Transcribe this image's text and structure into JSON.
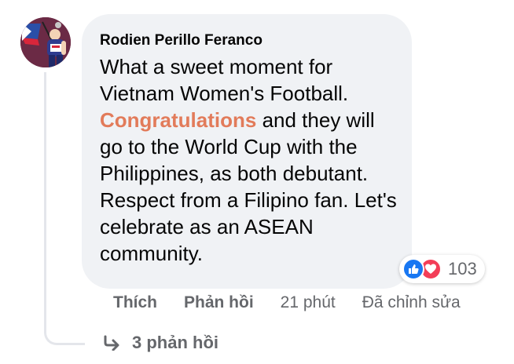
{
  "comment": {
    "author": "Rodien Perillo Feranco",
    "text_before": "What a sweet moment for Vietnam Women's Football.",
    "highlight": "Congratulations",
    "text_after": "and they will go to the World Cup with the Philippines, as both debutant. Respect from a Filipino fan. Let's celebrate as an ASEAN community."
  },
  "reactions": {
    "icons": [
      "like-icon",
      "love-icon"
    ],
    "count": "103",
    "like_color": "#1877f2",
    "love_color": "#f33e58"
  },
  "actions": {
    "like_label": "Thích",
    "reply_label": "Phản hồi",
    "time": "21 phút",
    "edited": "Đã chỉnh sửa"
  },
  "replies": {
    "label": "3 phản hồi",
    "icon": "reply-arrow-icon"
  },
  "colors": {
    "bubble": "#f0f2f5",
    "highlight": "#e27b5a",
    "meta_text": "#65676b"
  }
}
